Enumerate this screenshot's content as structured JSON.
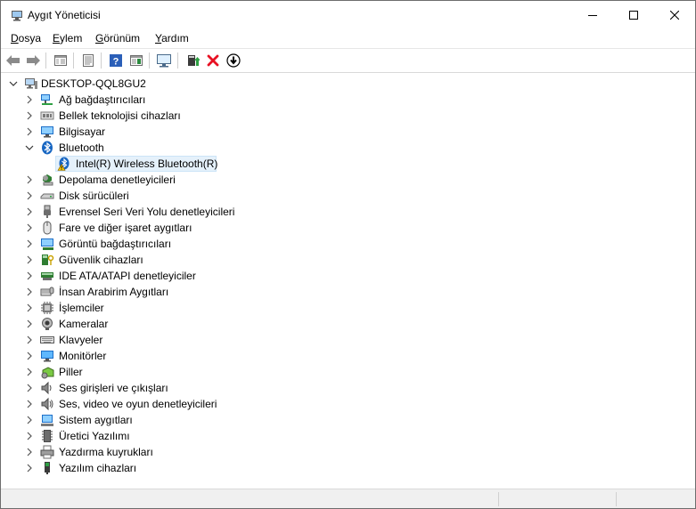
{
  "window": {
    "title": "Aygıt Yöneticisi",
    "controls": [
      "minimize",
      "maximize",
      "close"
    ]
  },
  "menu": [
    {
      "accel": "D",
      "rest": "osya"
    },
    {
      "accel": "E",
      "rest": "ylem"
    },
    {
      "accel": "G",
      "rest": "örünüm"
    },
    {
      "accel": "Y",
      "rest": "ardım"
    }
  ],
  "toolbar": {
    "icons": [
      "back-arrow-icon",
      "forward-arrow-icon",
      "show-hide-console-tree-icon",
      "properties-icon",
      "help-icon",
      "action-pane-icon",
      "scan-hardware-icon",
      "update-driver-icon",
      "uninstall-device-icon",
      "disable-device-icon"
    ]
  },
  "tree": {
    "root": "DESKTOP-QQL8GU2",
    "categories": [
      {
        "label": "Ağ bağdaştırıcıları",
        "icon": "network-adapter-icon",
        "expanded": false
      },
      {
        "label": "Bellek teknolojisi cihazları",
        "icon": "memory-technology-icon",
        "expanded": false
      },
      {
        "label": "Bilgisayar",
        "icon": "computer-icon",
        "expanded": false
      },
      {
        "label": "Bluetooth",
        "icon": "bluetooth-icon",
        "expanded": true,
        "children": [
          {
            "label": "Intel(R) Wireless Bluetooth(R)",
            "icon": "bluetooth-warning-icon",
            "selected": true
          }
        ]
      },
      {
        "label": "Depolama denetleyicileri",
        "icon": "storage-controller-icon",
        "expanded": false
      },
      {
        "label": "Disk sürücüleri",
        "icon": "disk-drive-icon",
        "expanded": false
      },
      {
        "label": "Evrensel Seri Veri Yolu denetleyicileri",
        "icon": "usb-icon",
        "expanded": false
      },
      {
        "label": "Fare ve diğer işaret aygıtları",
        "icon": "mouse-icon",
        "expanded": false
      },
      {
        "label": "Görüntü bağdaştırıcıları",
        "icon": "display-adapter-icon",
        "expanded": false
      },
      {
        "label": "Güvenlik cihazları",
        "icon": "security-device-icon",
        "expanded": false
      },
      {
        "label": "IDE ATA/ATAPI denetleyiciler",
        "icon": "ide-controller-icon",
        "expanded": false
      },
      {
        "label": "İnsan Arabirim Aygıtları",
        "icon": "hid-icon",
        "expanded": false
      },
      {
        "label": "İşlemciler",
        "icon": "processor-icon",
        "expanded": false
      },
      {
        "label": "Kameralar",
        "icon": "camera-icon",
        "expanded": false
      },
      {
        "label": "Klavyeler",
        "icon": "keyboard-icon",
        "expanded": false
      },
      {
        "label": "Monitörler",
        "icon": "monitor-icon",
        "expanded": false
      },
      {
        "label": "Piller",
        "icon": "battery-icon",
        "expanded": false
      },
      {
        "label": "Ses girişleri ve çıkışları",
        "icon": "speaker-icon",
        "expanded": false
      },
      {
        "label": "Ses, video ve oyun denetleyicileri",
        "icon": "sound-controller-icon",
        "expanded": false
      },
      {
        "label": "Sistem aygıtları",
        "icon": "system-devices-icon",
        "expanded": false
      },
      {
        "label": "Üretici Yazılımı",
        "icon": "firmware-icon",
        "expanded": false
      },
      {
        "label": "Yazdırma kuyrukları",
        "icon": "print-queue-icon",
        "expanded": false
      },
      {
        "label": "Yazılım cihazları",
        "icon": "software-device-icon",
        "expanded": false
      }
    ]
  },
  "colors": {
    "selection": "#e5f1fb",
    "selection_border": "#cce4f7",
    "accent": "#0078d7",
    "warning": "#f5c400",
    "error_red": "#e81123"
  }
}
